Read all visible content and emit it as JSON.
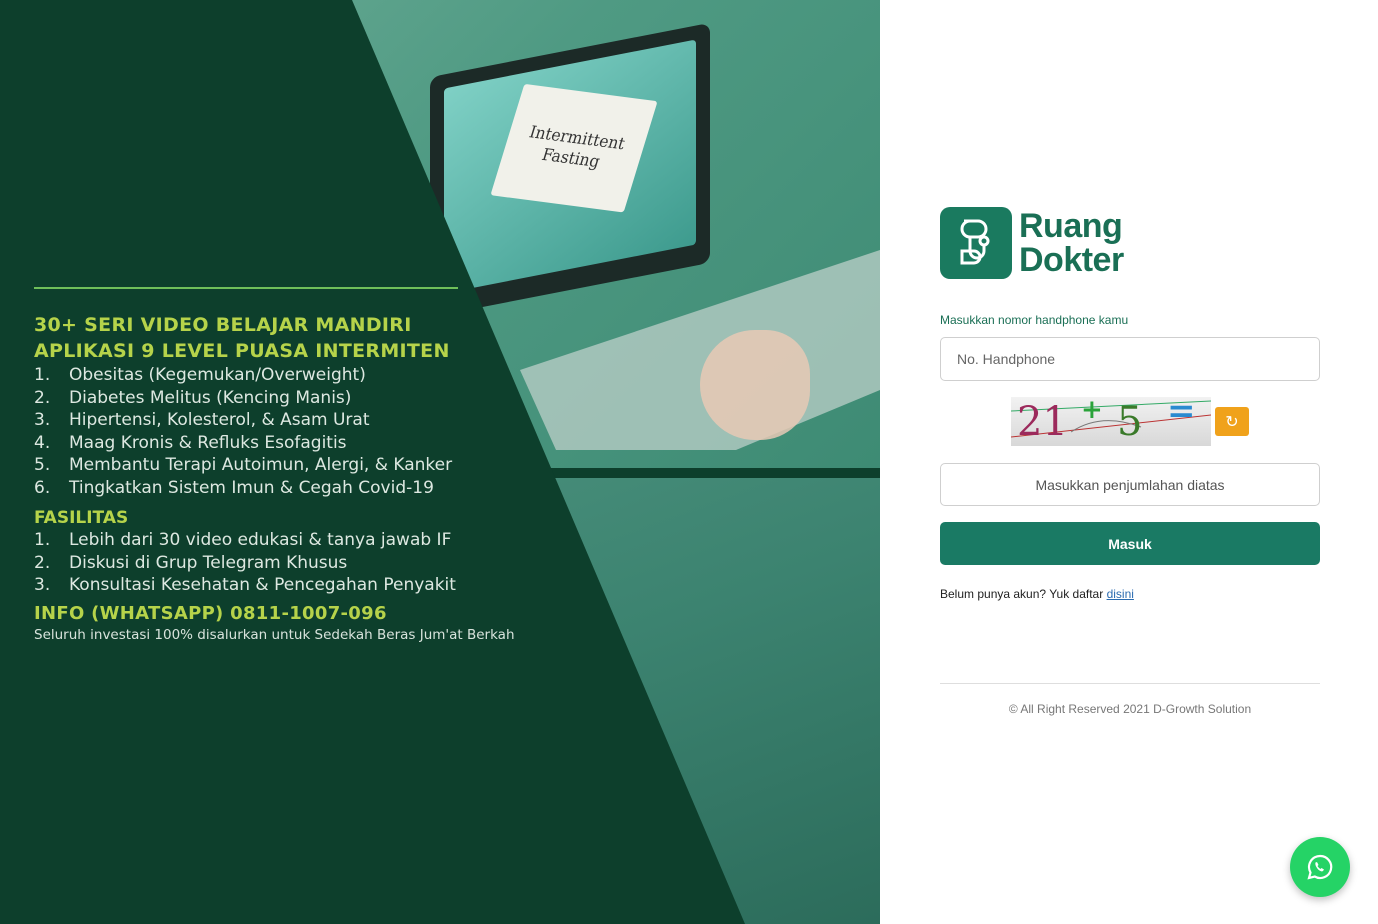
{
  "promo": {
    "heading1": "30+ SERI VIDEO BELAJAR MANDIRI",
    "heading2": "APLIKASI 9 LEVEL PUASA INTERMITEN",
    "benefits": [
      {
        "num": "1.",
        "text": "Obesitas (Kegemukan/Overweight)"
      },
      {
        "num": "2.",
        "text": "Diabetes Melitus (Kencing Manis)"
      },
      {
        "num": "3.",
        "text": "Hipertensi, Kolesterol, & Asam Urat"
      },
      {
        "num": "4.",
        "text": "Maag Kronis & Refluks Esofagitis"
      },
      {
        "num": "5.",
        "text": "Membantu Terapi Autoimun, Alergi, & Kanker"
      },
      {
        "num": "6.",
        "text": "Tingkatkan Sistem Imun & Cegah Covid-19"
      }
    ],
    "facilities_heading": "FASILITAS",
    "facilities": [
      {
        "num": "1.",
        "text": "Lebih dari 30 video edukasi & tanya jawab IF"
      },
      {
        "num": "2.",
        "text": "Diskusi di Grup Telegram Khusus"
      },
      {
        "num": "3.",
        "text": "Konsultasi Kesehatan & Pencegahan Penyakit"
      }
    ],
    "info": "INFO (WHATSAPP) 0811-1007-096",
    "footnote": "Seluruh investasi 100% disalurkan untuk Sedekah Beras Jum'at Berkah",
    "note_card_text": "Intermittent Fasting"
  },
  "brand": {
    "line1": "Ruang",
    "line2": "Dokter",
    "color": "#1a7a5f"
  },
  "login": {
    "phone_label": "Masukkan nomor handphone kamu",
    "phone_placeholder": "No. Handphone",
    "captcha": {
      "a": "21",
      "op": "+",
      "b": "5",
      "eq": "="
    },
    "sum_placeholder": "Masukkan penjumlahan diatas",
    "submit_label": "Masuk",
    "signup_text": "Belum punya akun? Yuk daftar ",
    "signup_link": "disini",
    "refresh_icon": "refresh-icon",
    "accent": "#f0a21b"
  },
  "footer": {
    "copyright": "© All Right Reserved 2021 D-Growth Solution"
  },
  "whatsapp": {
    "icon": "whatsapp-icon",
    "color": "#25d366"
  }
}
